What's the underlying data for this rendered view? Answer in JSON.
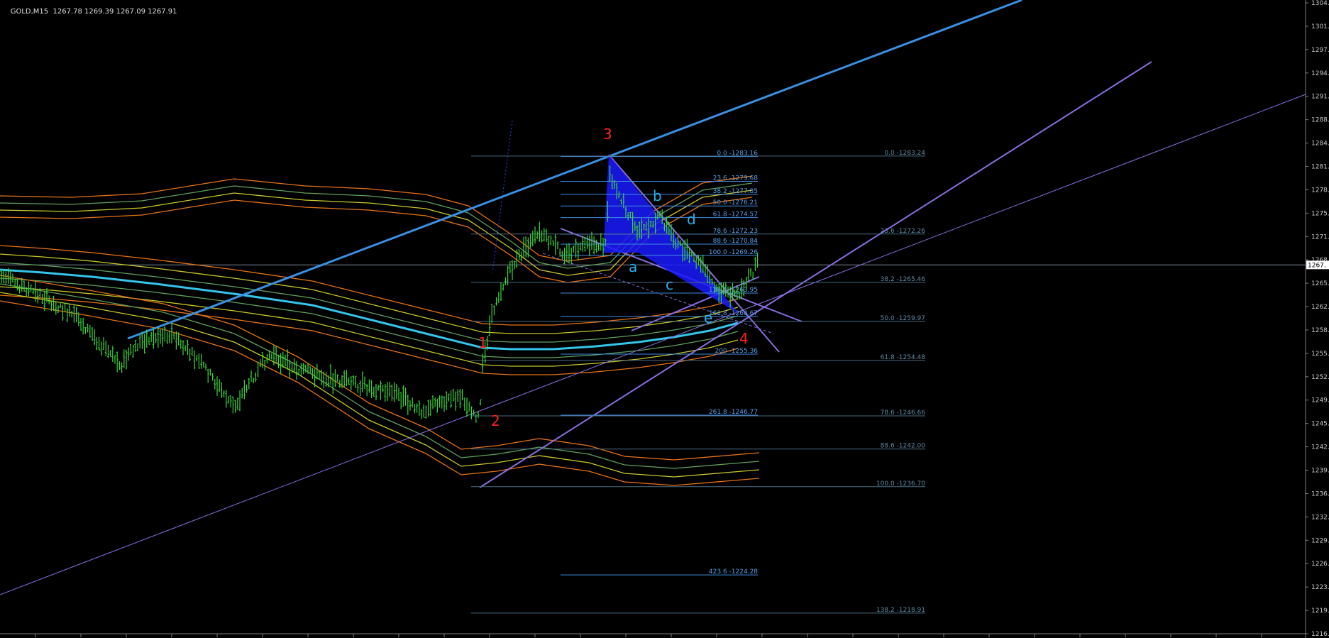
{
  "header": {
    "symbol": "GOLD,M15",
    "ohlc": "1267.78 1269.39 1267.09 1267.91"
  },
  "colors": {
    "background": "#000000",
    "grid_axis": "#808080",
    "candle": "#3bd23b",
    "ma_cyan": "#35c4ea",
    "band_orange": "#e67318",
    "band_yellow": "#c8c82a",
    "band_green": "#5fa05f",
    "trend_blue": "#3a8fe0",
    "trend_purple": "#8a6ee0",
    "fib_blue": "#3f8be0",
    "fib_gray": "#4a6a80",
    "wave_red": "#ff2020",
    "wave_cyan": "#28b0f0",
    "pattern_fill": "#1a1aff",
    "price_line": "#7a8a99",
    "current_price_box": "#ffffff"
  },
  "chart_data": {
    "type": "candlestick",
    "title": "GOLD,M15",
    "ylim": [
      1216,
      1304
    ],
    "current_price": "1267.",
    "y_ticks": [
      "1304.",
      "1301.",
      "1297.",
      "1294.",
      "1291.",
      "1288.",
      "1284.",
      "1281.",
      "1278.",
      "1275.",
      "1271.",
      "1268.",
      "1265.",
      "1262.",
      "1258.",
      "1255.",
      "1252.",
      "1249.",
      "1245.",
      "1242.",
      "1239.",
      "1236.",
      "1232.",
      "1229.",
      "1226.",
      "1223.",
      "1219.",
      "1216."
    ],
    "fib_left": [
      {
        "label": "0.0 -1283.16",
        "value": 1283.16,
        "style": "blue"
      },
      {
        "label": "23.6 -1279.68",
        "value": 1279.68,
        "style": "blue"
      },
      {
        "label": "38.2 -1277.85",
        "value": 1277.85,
        "style": "blue"
      },
      {
        "label": "50.0 -1276.21",
        "value": 1276.21,
        "style": "blue"
      },
      {
        "label": "61.8 -1274.57",
        "value": 1274.57,
        "style": "blue"
      },
      {
        "label": "78.6 -1272.23",
        "value": 1272.23,
        "style": "blue"
      },
      {
        "label": "88.6 -1270.84",
        "value": 1270.84,
        "style": "blue"
      },
      {
        "label": "100.0 -1269.26",
        "value": 1269.26,
        "style": "blue"
      },
      {
        "label": "138.2 -1263.95",
        "value": 1263.95,
        "style": "blue"
      },
      {
        "label": "161.8 -1260.67",
        "value": 1260.67,
        "style": "blue"
      },
      {
        "label": "200 -1255.36",
        "value": 1255.36,
        "style": "blue"
      },
      {
        "label": "261.8 -1246.77",
        "value": 1246.77,
        "style": "blue"
      },
      {
        "label": "423.6 -1224.28",
        "value": 1224.28,
        "style": "blue"
      }
    ],
    "fib_right": [
      {
        "label": "0.0 -1283.24",
        "value": 1283.24
      },
      {
        "label": "23.6 -1272.26",
        "value": 1272.26
      },
      {
        "label": "38.2 -1265.46",
        "value": 1265.46
      },
      {
        "label": "50.0 -1259.97",
        "value": 1259.97
      },
      {
        "label": "61.8 -1254.48",
        "value": 1254.48
      },
      {
        "label": "78.6 -1246.66",
        "value": 1246.66
      },
      {
        "label": "88.6 -1242.00",
        "value": 1242.0
      },
      {
        "label": "100.0 -1236.70",
        "value": 1236.7
      },
      {
        "label": "138.2 -1218.91",
        "value": 1218.91
      }
    ],
    "wave_labels_red": [
      "1",
      "2",
      "3",
      "4"
    ],
    "wave_labels_cyan": [
      "a",
      "b",
      "c",
      "d",
      "e"
    ]
  }
}
